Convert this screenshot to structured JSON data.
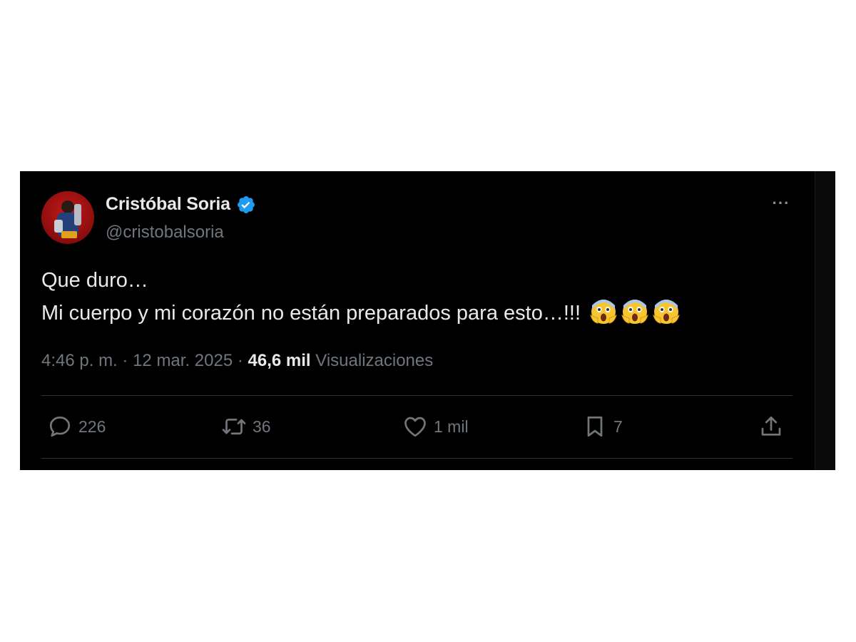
{
  "author": {
    "display_name": "Cristóbal Soria",
    "handle": "@cristobalsoria",
    "verified": true
  },
  "tweet": {
    "lines": [
      "Que duro…",
      "Mi cuerpo y mi corazón no están preparados para esto…!!!"
    ],
    "emoji": [
      "😱",
      "😱",
      "😱"
    ]
  },
  "meta": {
    "time": "4:46 p. m.",
    "separator": "·",
    "date": "12 mar. 2025",
    "views_count": "46,6 mil",
    "views_label": "Visualizaciones"
  },
  "actions": {
    "replies": "226",
    "retweets": "36",
    "likes": "1 mil",
    "bookmarks": "7"
  },
  "colors": {
    "background": "#000000",
    "text_primary": "#e7e9ea",
    "text_secondary": "#71767b",
    "divider": "#2f3336",
    "verified_blue": "#1d9bf0"
  },
  "icons": [
    "more-icon",
    "verified-badge-icon",
    "reply-icon",
    "retweet-icon",
    "like-icon",
    "bookmark-icon",
    "share-icon"
  ]
}
